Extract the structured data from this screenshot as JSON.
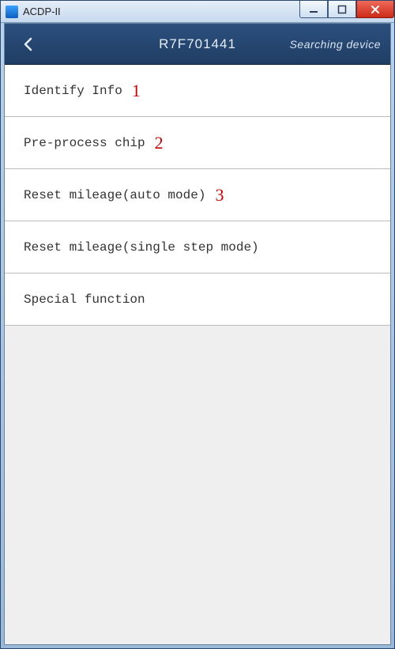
{
  "window": {
    "title": "ACDP-II"
  },
  "header": {
    "title": "R7F701441",
    "status": "Searching device"
  },
  "menu": {
    "items": [
      {
        "label": "Identify Info",
        "annotation": "1"
      },
      {
        "label": "Pre-process chip",
        "annotation": "2"
      },
      {
        "label": "Reset mileage(auto mode)",
        "annotation": "3"
      },
      {
        "label": "Reset mileage(single step mode)",
        "annotation": ""
      },
      {
        "label": "Special function",
        "annotation": ""
      }
    ]
  }
}
